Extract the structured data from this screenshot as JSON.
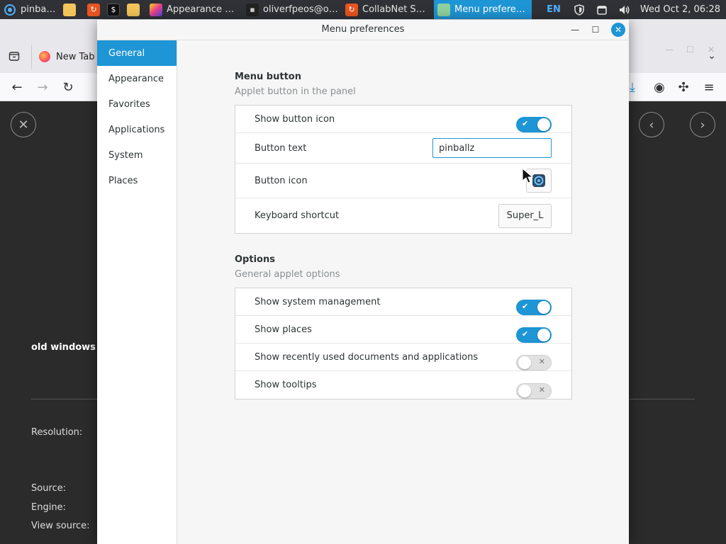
{
  "taskbar": {
    "items": [
      {
        "label": "pinballz",
        "icon": "pinballz-icon"
      },
      {
        "label": "",
        "icon": "folder-icon"
      },
      {
        "label": "",
        "icon": "update-icon"
      },
      {
        "label": "",
        "icon": "terminal-icon"
      },
      {
        "label": "",
        "icon": "files-icon"
      },
      {
        "label": "Appearance Pr...",
        "icon": "appearance-icon"
      },
      {
        "label": "oliverfpeos@oli...",
        "icon": "terminal-icon"
      },
      {
        "label": "CollabNet Sear...",
        "icon": "app-icon"
      },
      {
        "label": "Menu preferen...",
        "icon": "menu-app-icon"
      }
    ],
    "language": "EN",
    "clock": "Wed Oct  2, 06:28"
  },
  "browser": {
    "tab_label": "New Tab",
    "page": {
      "heading": "old windows ic",
      "resolution_label": "Resolution:",
      "source_label": "Source:",
      "engine_label": "Engine:",
      "view_source_label": "View source:"
    }
  },
  "dialog": {
    "title": "Menu preferences",
    "sidebar": {
      "items": [
        {
          "label": "General"
        },
        {
          "label": "Appearance"
        },
        {
          "label": "Favorites"
        },
        {
          "label": "Applications"
        },
        {
          "label": "System"
        },
        {
          "label": "Places"
        }
      ]
    },
    "menu_button": {
      "title": "Menu button",
      "subtitle": "Applet button in the panel",
      "show_button_icon_label": "Show button icon",
      "show_button_icon": true,
      "button_text_label": "Button text",
      "button_text_value": "pinballz",
      "button_icon_label": "Button icon",
      "keyboard_shortcut_label": "Keyboard shortcut",
      "keyboard_shortcut_value": "Super_L"
    },
    "options": {
      "title": "Options",
      "subtitle": "General applet options",
      "rows": [
        {
          "label": "Show system management",
          "on": true
        },
        {
          "label": "Show places",
          "on": true
        },
        {
          "label": "Show recently used documents and applications",
          "on": false
        },
        {
          "label": "Show tooltips",
          "on": false
        }
      ]
    }
  },
  "colors": {
    "accent": "#1e95d4",
    "taskbar_bg": "#2f3136",
    "dialog_bg": "#f6f6f6"
  }
}
